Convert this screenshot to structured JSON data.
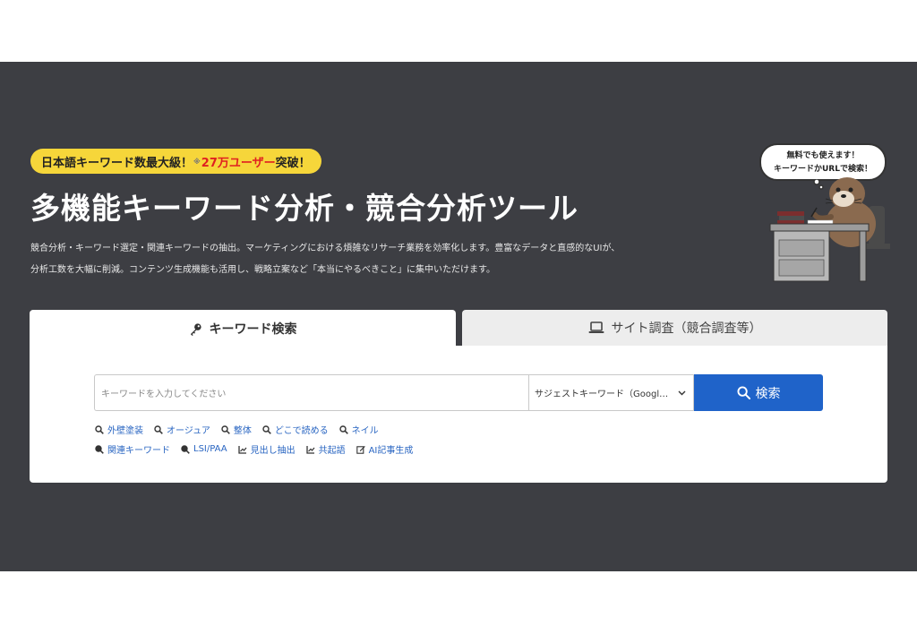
{
  "badge": {
    "part1": "日本語キーワード数最大級！",
    "mark": "※",
    "highlight": "27万ユーザー",
    "part2": "突破！"
  },
  "hero": {
    "title": "多機能キーワード分析・競合分析ツール",
    "desc_line1": "競合分析・キーワード選定・関連キーワードの抽出。マーケティングにおける煩雑なリサーチ業務を効率化します。豊富なデータと直感的なUIが、",
    "desc_line2": "分析工数を大幅に削減。コンテンツ生成機能も活用し、戦略立案など「本当にやるべきこと」に集中いただけます。"
  },
  "mascot": {
    "bubble_line1": "無料でも使えます！",
    "bubble_line2": "キーワードかURLで検索！"
  },
  "tabs": [
    {
      "label": "キーワード検索",
      "icon": "key-icon",
      "active": true
    },
    {
      "label": "サイト調査（競合調査等）",
      "icon": "laptop-icon",
      "active": false
    }
  ],
  "search": {
    "placeholder": "キーワードを入力してください",
    "select_value": "サジェストキーワード（Googl…",
    "button_label": "検索"
  },
  "quick_links": [
    "外壁塗装",
    "オージュア",
    "整体",
    "どこで読める",
    "ネイル"
  ],
  "tools": [
    {
      "label": "関連キーワード",
      "icon": "search-icon"
    },
    {
      "label": "LSI/PAA",
      "icon": "search-icon"
    },
    {
      "label": "見出し抽出",
      "icon": "chart-icon"
    },
    {
      "label": "共起語",
      "icon": "chart-icon"
    },
    {
      "label": "AI記事生成",
      "icon": "edit-icon"
    }
  ],
  "colors": {
    "hero_bg": "#3d3e43",
    "badge_bg": "#f6d63a",
    "accent_red": "#e02020",
    "button_blue": "#1f63c9",
    "link_blue": "#2a66c2"
  }
}
